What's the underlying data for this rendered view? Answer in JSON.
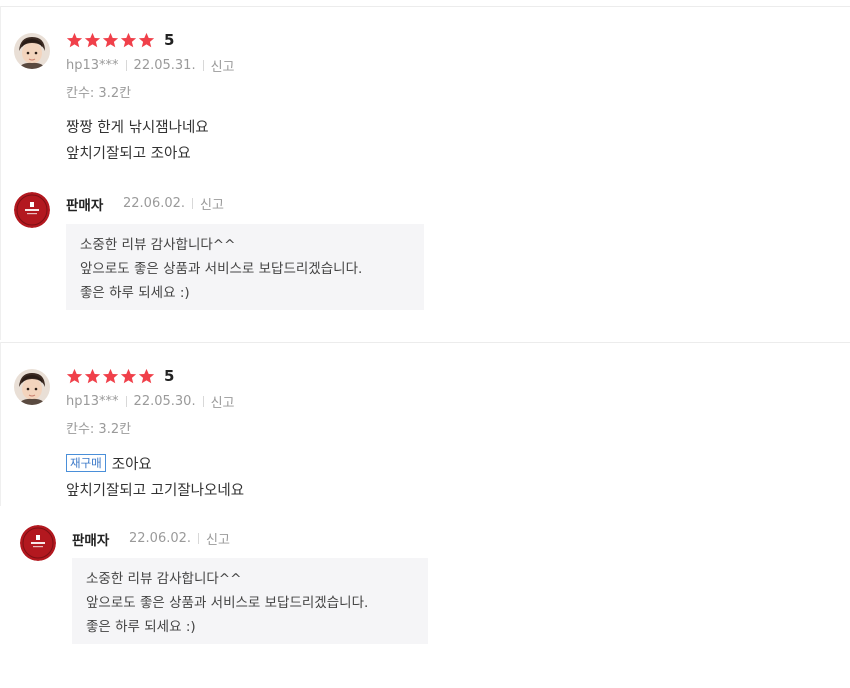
{
  "reviews": [
    {
      "rating": "5",
      "stars_filled": 5,
      "user": "hp13***",
      "date": "22.05.31.",
      "report": "신고",
      "option": "칸수: 3.2칸",
      "badge": "",
      "lines": [
        "짱짱 한게 낚시잼나네요",
        "앞치기잘되고 조아요"
      ],
      "seller": {
        "label": "판매자",
        "date": "22.06.02.",
        "report": "신고",
        "reply": [
          "소중한 리뷰 감사합니다^^",
          "앞으로도 좋은 상품과 서비스로 보답드리겠습니다.",
          "좋은 하루 되세요 :)"
        ]
      }
    },
    {
      "rating": "5",
      "stars_filled": 5,
      "user": "hp13***",
      "date": "22.05.30.",
      "report": "신고",
      "option": "칸수: 3.2칸",
      "badge": "재구매",
      "lines": [
        "조아요",
        "앞치기잘되고 고기잘나오네요"
      ],
      "seller": {
        "label": "판매자",
        "date": "22.06.02.",
        "report": "신고",
        "reply": [
          "소중한 리뷰 감사합니다^^",
          "앞으로도 좋은 상품과 서비스로 보답드리겠습니다.",
          "좋은 하루 되세요 :)"
        ]
      }
    }
  ],
  "colors": {
    "star": "#f0404a",
    "badge_border": "#4a8fd9",
    "reply_bg": "#f5f5f7",
    "seller_logo": "#b3181f"
  },
  "icons": {
    "star": "star-icon",
    "user_avatar": "user-avatar",
    "seller_logo": "seller-logo-icon"
  }
}
